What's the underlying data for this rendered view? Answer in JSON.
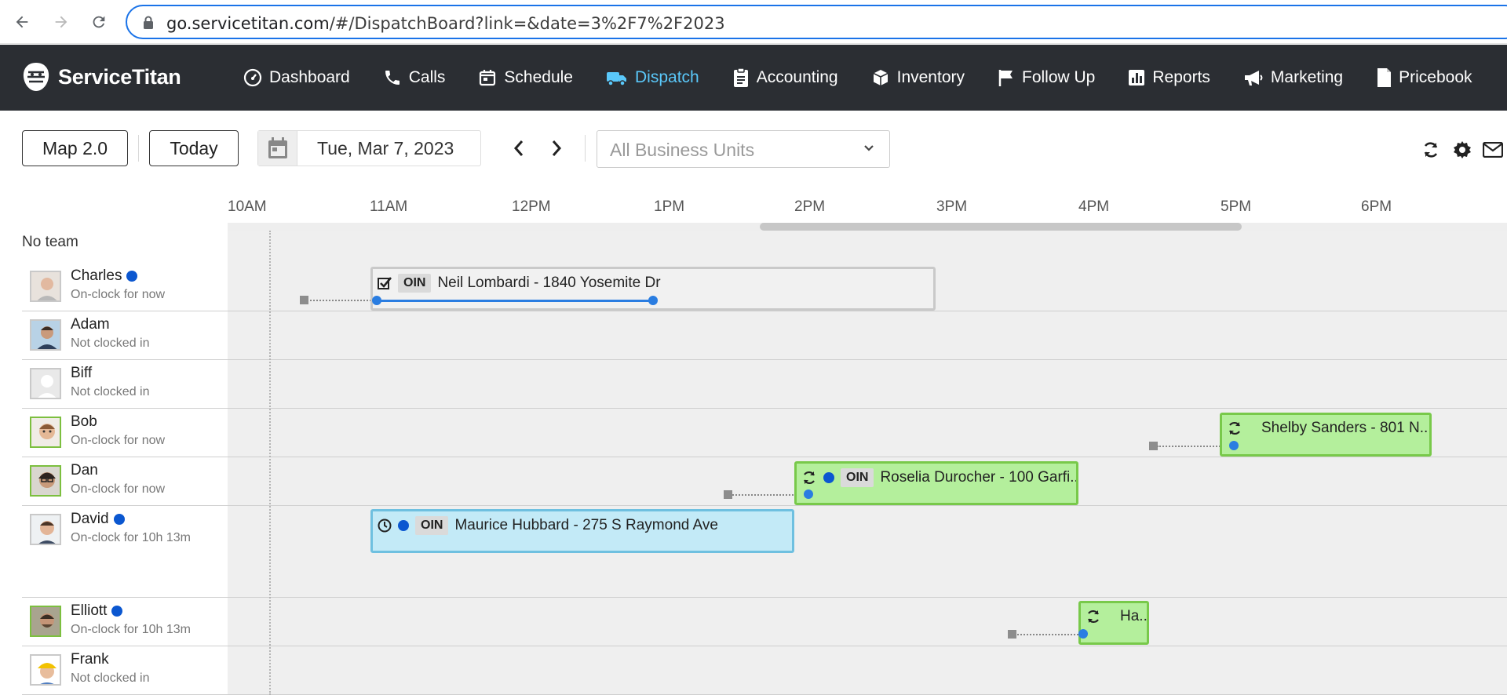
{
  "browser": {
    "url_host": "go.servicetitan.com",
    "url_path": "/#/DispatchBoard?link=&date=3%2F7%2F2023"
  },
  "app": {
    "brand": "ServiceTitan",
    "nav": [
      {
        "label": "Dashboard",
        "icon": "dashboard-icon"
      },
      {
        "label": "Calls",
        "icon": "phone-icon"
      },
      {
        "label": "Schedule",
        "icon": "calendar-icon"
      },
      {
        "label": "Dispatch",
        "icon": "truck-icon",
        "active": true
      },
      {
        "label": "Accounting",
        "icon": "clipboard-icon"
      },
      {
        "label": "Inventory",
        "icon": "box-icon"
      },
      {
        "label": "Follow Up",
        "icon": "flag-icon"
      },
      {
        "label": "Reports",
        "icon": "bar-chart-icon"
      },
      {
        "label": "Marketing",
        "icon": "megaphone-icon"
      },
      {
        "label": "Pricebook",
        "icon": "book-icon"
      }
    ],
    "active_color": "#5ac8fa"
  },
  "toolbar": {
    "map_button": "Map 2.0",
    "today_button": "Today",
    "date": "Tue, Mar 7, 2023",
    "business_units_placeholder": "All Business Units"
  },
  "timeline": {
    "hours": [
      "10AM",
      "11AM",
      "12PM",
      "1PM",
      "2PM",
      "3PM",
      "4PM",
      "5PM",
      "6PM"
    ]
  },
  "team": "No team",
  "technicians": [
    {
      "name": "Charles",
      "status": "On-clock for now",
      "online": true
    },
    {
      "name": "Adam",
      "status": "Not clocked in",
      "online": false
    },
    {
      "name": "Biff",
      "status": "Not clocked in",
      "online": false
    },
    {
      "name": "Bob",
      "status": "On-clock for now",
      "online": false
    },
    {
      "name": "Dan",
      "status": "On-clock for now",
      "online": false
    },
    {
      "name": "David",
      "status": "On-clock for 10h 13m",
      "online": true
    },
    {
      "name": "Elliott",
      "status": "On-clock for 10h 13m",
      "online": true
    },
    {
      "name": "Frank",
      "status": "Not clocked in",
      "online": false
    }
  ],
  "jobs": [
    {
      "tech": "Charles",
      "tag": "OIN",
      "title": "Neil Lombardi - 1840 Yosemite Dr",
      "status": "grey"
    },
    {
      "tech": "Bob",
      "tag": "",
      "title": "Shelby Sanders - 801 N...",
      "status": "green"
    },
    {
      "tech": "Dan",
      "tag": "OIN",
      "title": "Roselia Durocher - 100 Garfi...",
      "status": "green"
    },
    {
      "tech": "David",
      "tag": "OIN",
      "title": "Maurice Hubbard - 275 S Raymond Ave",
      "status": "blue"
    },
    {
      "tech": "Elliott",
      "tag": "",
      "title": "Ha...",
      "status": "green"
    }
  ]
}
